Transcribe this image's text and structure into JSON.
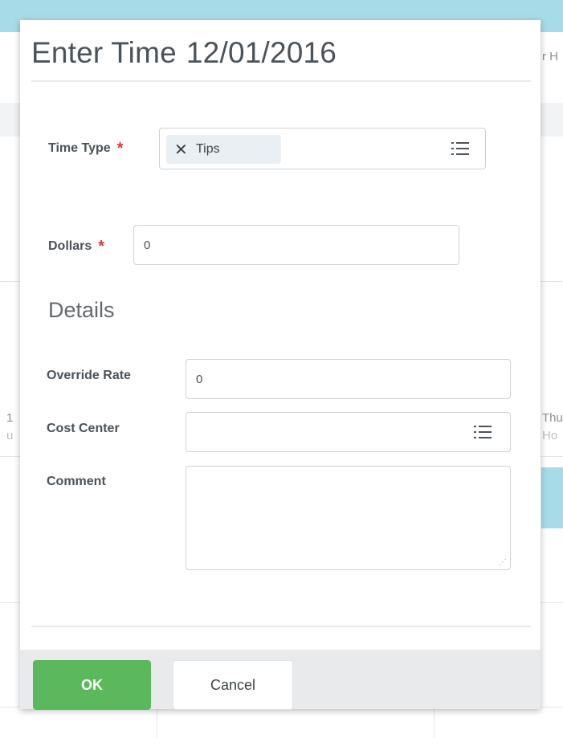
{
  "dialog": {
    "title": "Enter Time",
    "date": "12/01/2016"
  },
  "fields": {
    "time_type": {
      "label": "Time Type",
      "required_mark": "*",
      "selected_value": "Tips",
      "remove_glyph": "✕",
      "icon": "list-icon"
    },
    "dollars": {
      "label": "Dollars",
      "required_mark": "*",
      "value": "0"
    },
    "details_heading": "Details",
    "override_rate": {
      "label": "Override Rate",
      "value": "0"
    },
    "cost_center": {
      "label": "Cost Center",
      "value": "",
      "icon": "list-icon"
    },
    "comment": {
      "label": "Comment",
      "value": ""
    }
  },
  "buttons": {
    "ok": "OK",
    "cancel": "Cancel"
  },
  "background": {
    "right_header_fragment": "r H",
    "left_fragment": "1",
    "left_sub_fragment": "u",
    "right_fragment": "Thu",
    "right_sub_fragment": "Ho"
  },
  "colors": {
    "primary_button": "#5cb85c",
    "required": "#e0383e",
    "header_band": "#a8dbe8"
  }
}
